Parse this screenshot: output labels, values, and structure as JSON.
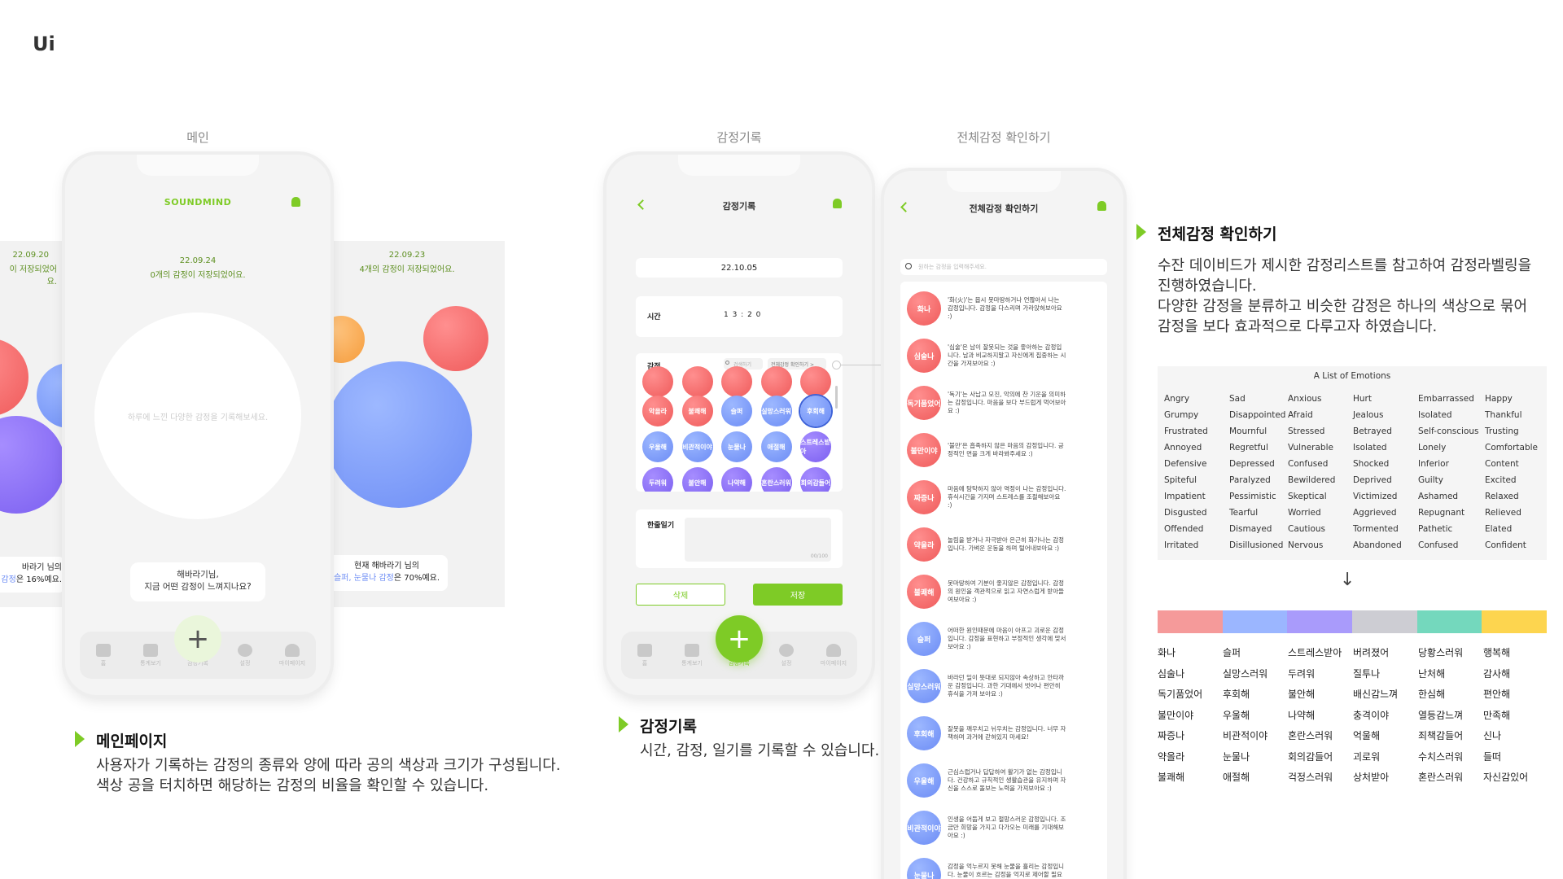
{
  "header": {
    "label": "Ui"
  },
  "captions": {
    "main": "메인",
    "record": "감정기록",
    "all": "전체감정 확인하기"
  },
  "main_phone": {
    "logo": "SOUNDMIND",
    "date": "22.09.24",
    "saved": "0개의 감정이 저장되었어요.",
    "placeholder": "하루에 느낀 다양한 감정을 기록해보세요.",
    "bubble_line1": "해바라기님,",
    "bubble_line2": "지금 어떤 감정이 느껴지나요?",
    "fab": "+",
    "tabs": [
      "홈",
      "통계보기",
      "감정기록",
      "설정",
      "마이페이지"
    ]
  },
  "left_card": {
    "date": "22.09.20",
    "saved": "이 저장되었어요.",
    "line1": "바라기 님의",
    "line2a": "감정",
    "line2b": "은 16%예요."
  },
  "right_card": {
    "date": "22.09.23",
    "saved": "4개의 감정이 저장되었어요.",
    "line1": "현재 해바라기 님의",
    "line2a": "슬퍼, 눈물나 감정",
    "line2b": "은 70%예요."
  },
  "record_phone": {
    "title": "감정기록",
    "date": "22.10.05",
    "time_label": "시간",
    "time_value": "1 3 : 2 0",
    "emotion_label": "감정",
    "search_placeholder": "검색하기",
    "all_link": "전체감정 확인하기 >",
    "chips_row1": [
      "악을라",
      "불쾌해",
      "슬퍼",
      "실망스러워",
      "후회해"
    ],
    "chips_row2": [
      "우울해",
      "비관적이야",
      "눈물나",
      "애절해",
      "스트레스받아"
    ],
    "chips_row3": [
      "두려워",
      "불안해",
      "나약해",
      "혼란스러워",
      "회의감들어"
    ],
    "diary_label": "한줄일기",
    "counter": "00/100",
    "delete_label": "삭제",
    "save_label": "저장",
    "fab": "+",
    "tabs": [
      "홈",
      "통계보기",
      "감정기록",
      "설정",
      "마이페이지"
    ]
  },
  "all_phone": {
    "title": "전체감정 확인하기",
    "search_placeholder": "원하는 감정을 입력해주세요.",
    "items": [
      {
        "name": "화나",
        "desc": "'화(火)'는 몹시 못마땅하거나 언짢아서 나는 감정입니다. 감정을 다스리며 가라앉혀보아요 :)"
      },
      {
        "name": "심술나",
        "desc": "'심술'은 남이 잘못되는 것을 좋아하는 감정입니다. 남과 비교하지말고 자신에게 집중하는 시간을 가져보아요 :)"
      },
      {
        "name": "독기품었어",
        "desc": "'독기'는 사납고 모진, 악의에 찬 기운을 의미하는 감정입니다. 마음을 보다 부드럽게 먹어보아요 :)"
      },
      {
        "name": "불만이야",
        "desc": "'불만'은 흡족하지 않은 마음의 감정입니다. 긍정적인 면을 크게 바라봐주세요 :)"
      },
      {
        "name": "짜증나",
        "desc": "마음에 탐탁하지 않아 역정이 나는 감정입니다. 휴식시간을 가지며 스트레스를 조절해보아요 :)"
      },
      {
        "name": "약올라",
        "desc": "놀림을 받거나 자극받아 은근히 화가나는 감정입니다. 가벼운 운동을 하며 털어내보아요 :)"
      },
      {
        "name": "불쾌해",
        "desc": "못마땅하여 기분이 좋지않은 감정입니다. 감정의 원인을 객관적으로 읽고 자연스럽게 받아들여보아요 :)"
      },
      {
        "name": "슬퍼",
        "desc": "어떠한 원인때문에 마음이 아프고 괴로운 감정입니다. 감정을 표현하고 부정적인 생각에 맞서보아요 :)"
      },
      {
        "name": "실망스러워",
        "desc": "바라던 일이 뜻대로 되지않아 속상하고 안타까운 감정입니다. 과한 기대에서 벗어나 편안히 휴식을 가져 보아요 :)"
      },
      {
        "name": "후회해",
        "desc": "잘못을 깨우치고 뉘우치는 감정입니다. 너무 자책하며 과거에 갇혀있지 마세요!"
      },
      {
        "name": "우울해",
        "desc": "근심스럽거나 답답하여 활기가 없는 감정입니다. 건강하고 규칙적인 생활습관을 유지하며 자신을 스스로 돌보는 노력을 가져보아요 :)"
      },
      {
        "name": "비관적이야",
        "desc": "인생을 어둡게 보고 절망스러운 감정입니다. 조금만 희망을 가지고 다가오는 미래를 기대해보아요 :)"
      },
      {
        "name": "눈물나",
        "desc": "감정을 억누르지 못해 눈물을 흘리는 감정입니다. 눈물이 흐르는 감정을 억지로 제어할 필요는 없지"
      }
    ]
  },
  "sections": {
    "main_title": "메인페이지",
    "main_body1": "사용자가 기록하는 감정의 종류와 양에 따라 공의 색상과 크기가 구성됩니다.",
    "main_body2": "색상 공을 터치하면 해당하는 감정의 비율을 확인할 수 있습니다.",
    "record_title": "감정기록",
    "record_body": "시간, 감정, 일기를 기록할 수 있습니다.",
    "all_title": "전체감정 확인하기",
    "all_body1": "수잔 데이비드가 제시한 감정리스트를 참고하여 감정라벨링을",
    "all_body2": "진행하였습니다.",
    "all_body3": "다양한 감정을 분류하고 비슷한 감정은 하나의 색상으로 묶어",
    "all_body4": "감정을 보다 효과적으로 다루고자 하였습니다."
  },
  "emotions_table": {
    "title": "A List of Emotions",
    "columns": [
      [
        "Angry",
        "Grumpy",
        "Frustrated",
        "Annoyed",
        "Defensive",
        "Spiteful",
        "Impatient",
        "Disgusted",
        "Offended",
        "Irritated"
      ],
      [
        "Sad",
        "Disappointed",
        "Mournful",
        "Regretful",
        "Depressed",
        "Paralyzed",
        "Pessimistic",
        "Tearful",
        "Dismayed",
        "Disillusioned"
      ],
      [
        "Anxious",
        "Afraid",
        "Stressed",
        "Vulnerable",
        "Confused",
        "Bewildered",
        "Skeptical",
        "Worried",
        "Cautious",
        "Nervous"
      ],
      [
        "Hurt",
        "Jealous",
        "Betrayed",
        "Isolated",
        "Shocked",
        "Deprived",
        "Victimized",
        "Aggrieved",
        "Tormented",
        "Abandoned"
      ],
      [
        "Embarrassed",
        "Isolated",
        "Self-conscious",
        "Lonely",
        "Inferior",
        "Guilty",
        "Ashamed",
        "Repugnant",
        "Pathetic",
        "Confused"
      ],
      [
        "Happy",
        "Thankful",
        "Trusting",
        "Comfortable",
        "Content",
        "Excited",
        "Relaxed",
        "Relieved",
        "Elated",
        "Confident"
      ]
    ],
    "arrow": "↓",
    "colors": [
      "#f59a9a",
      "#9bb6ff",
      "#a99bfb",
      "#cdcdd3",
      "#74d8bd",
      "#fdd54f"
    ],
    "korean_columns": [
      [
        "화나",
        "심술나",
        "독기품었어",
        "불만이야",
        "짜증나",
        "약올라",
        "불쾌해"
      ],
      [
        "슬퍼",
        "실망스러워",
        "후회해",
        "우울해",
        "비관적이야",
        "눈물나",
        "애절해"
      ],
      [
        "스트레스받아",
        "두려워",
        "불안해",
        "나약해",
        "혼란스러워",
        "회의감들어",
        "걱정스러워"
      ],
      [
        "버려졌어",
        "질투나",
        "배신감느껴",
        "충격이야",
        "억울해",
        "괴로워",
        "상처받아"
      ],
      [
        "당황스러워",
        "난처해",
        "한심해",
        "열등감느껴",
        "죄책감들어",
        "수치스러워",
        "혼란스러워"
      ],
      [
        "행복해",
        "감사해",
        "편안해",
        "만족해",
        "신나",
        "들떠",
        "자신감있어"
      ]
    ]
  },
  "colors": {
    "accent": "#7ecb26",
    "red": "#ef5a5a",
    "blue": "#6c8cf5",
    "purple": "#7b5ff0"
  }
}
